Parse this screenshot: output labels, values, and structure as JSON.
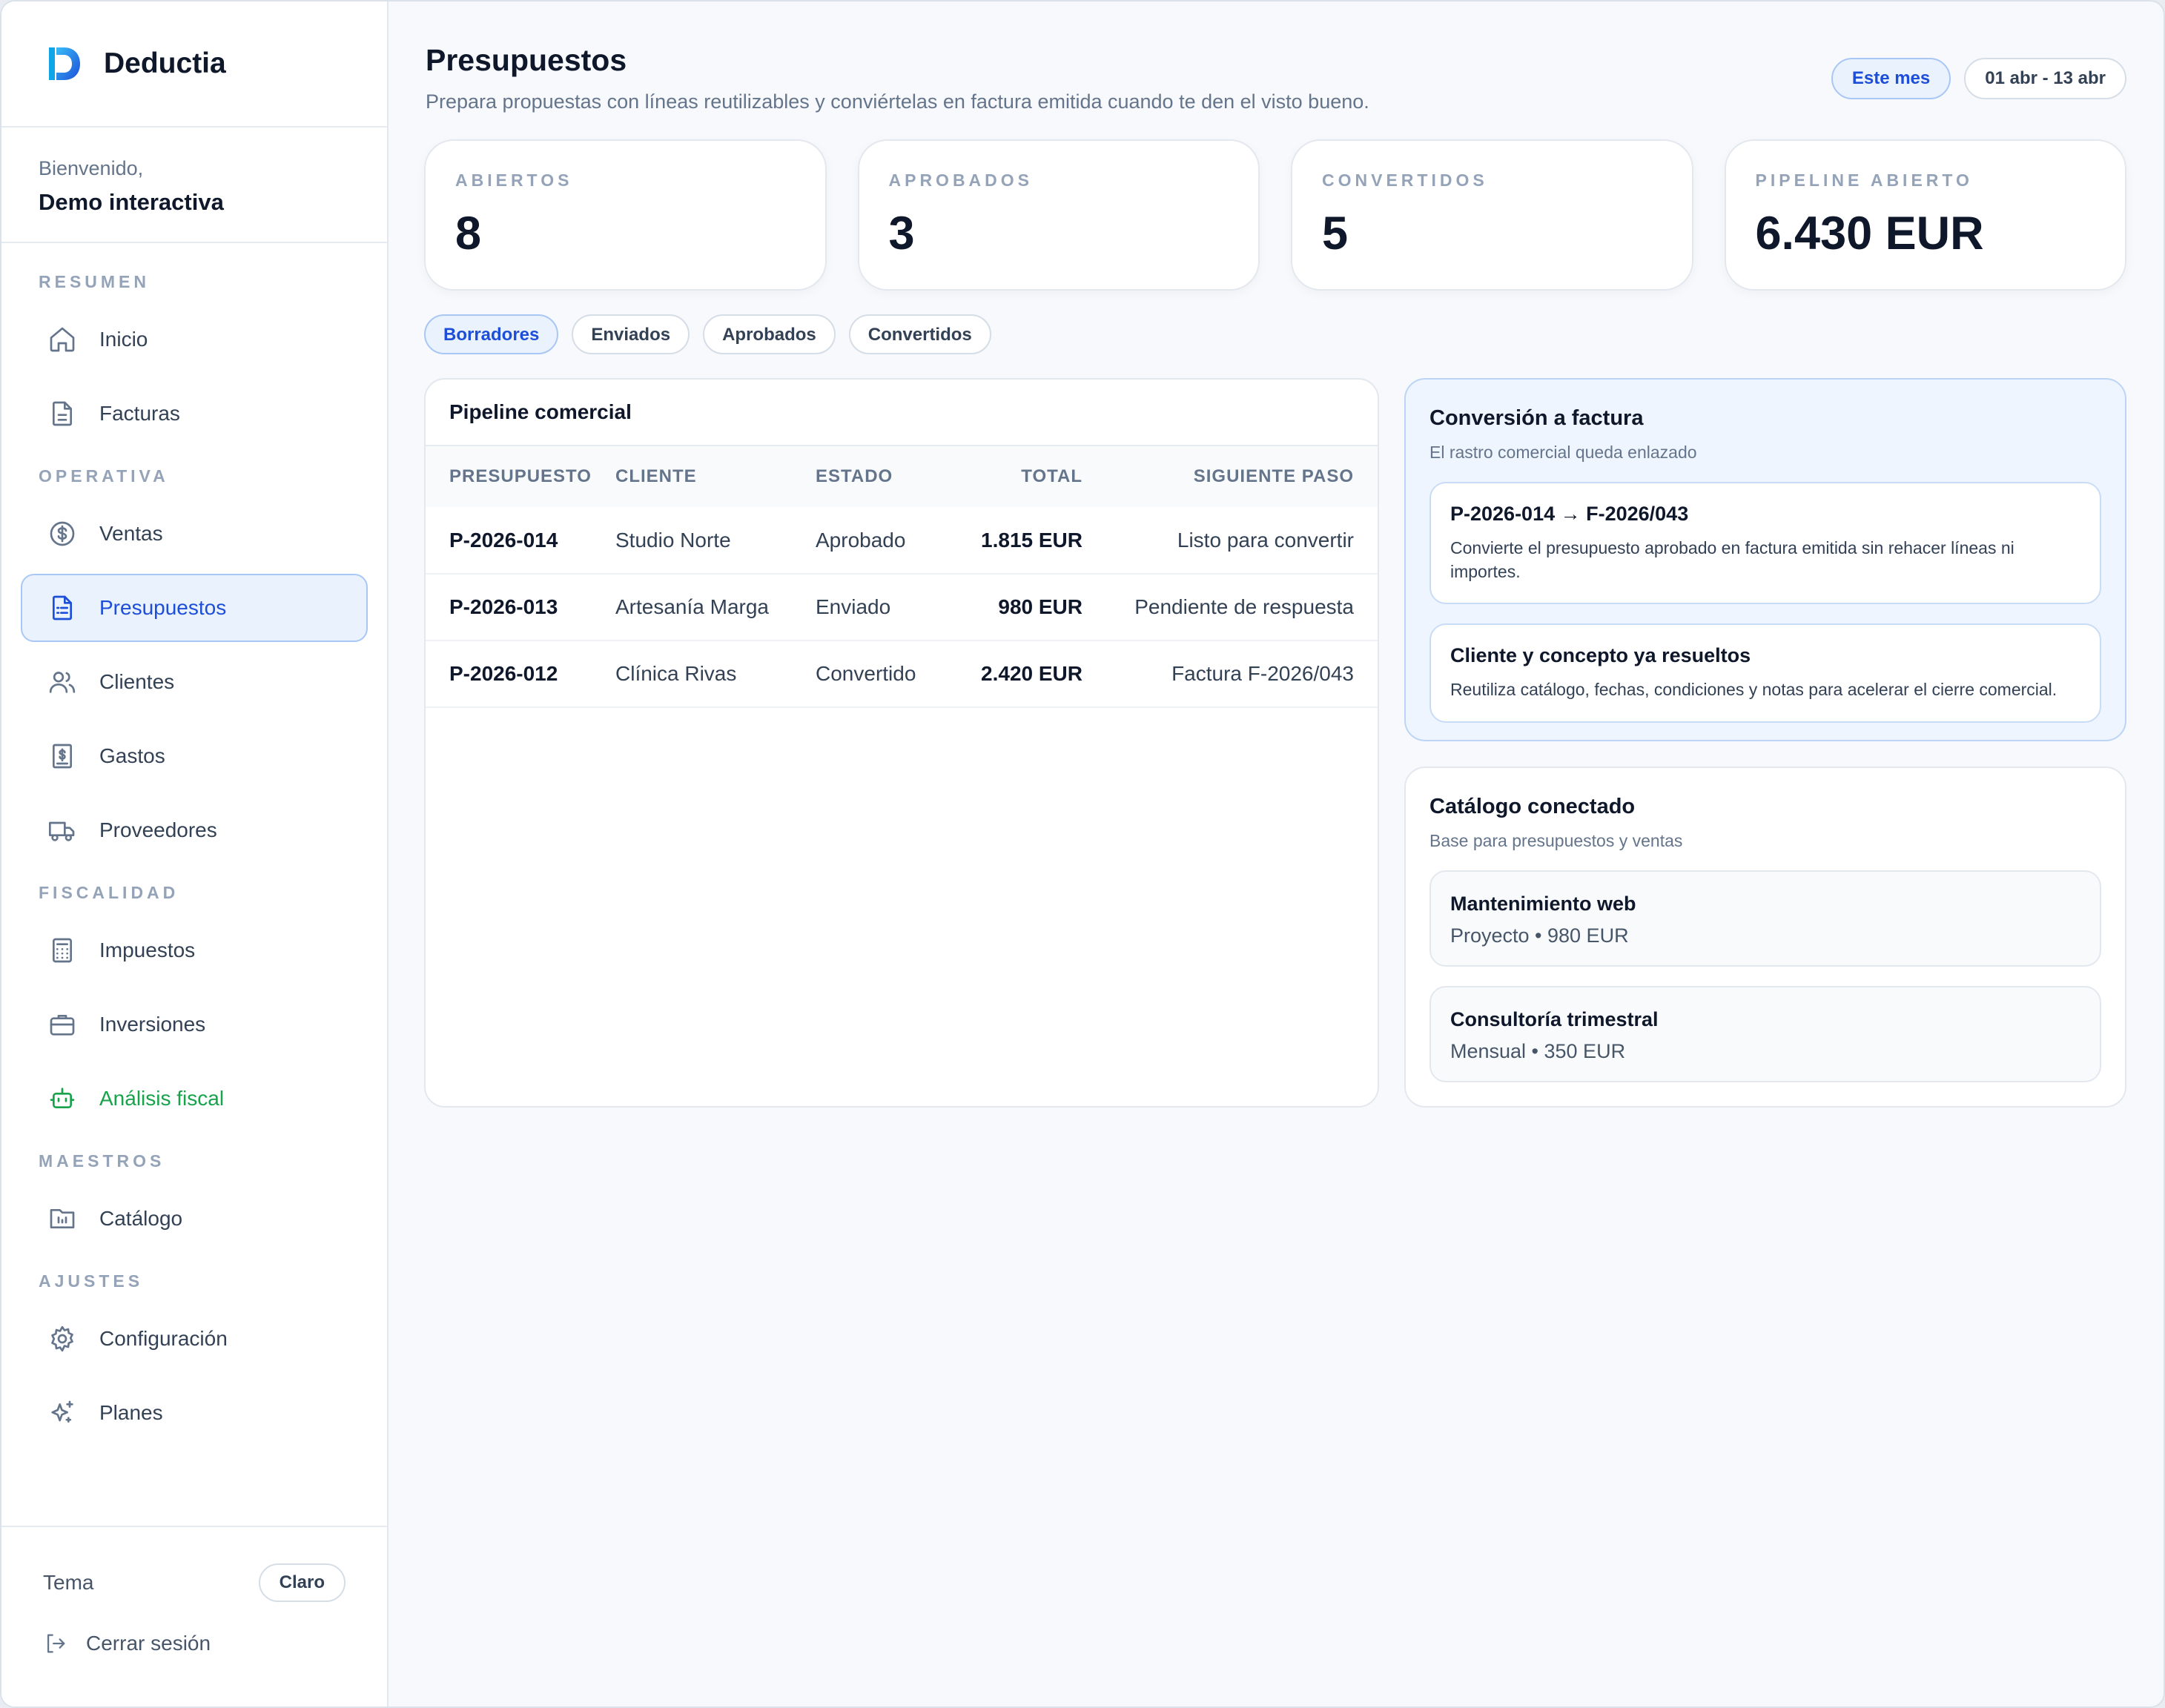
{
  "app": {
    "name": "Deductia",
    "welcome_label": "Bienvenido,",
    "user_name": "Demo interactiva"
  },
  "sidebar": {
    "sections": [
      {
        "title": "RESUMEN",
        "items": [
          {
            "label": "Inicio",
            "icon": "home-icon"
          },
          {
            "label": "Facturas",
            "icon": "file-icon"
          }
        ]
      },
      {
        "title": "OPERATIVA",
        "items": [
          {
            "label": "Ventas",
            "icon": "dollar-circle-icon"
          },
          {
            "label": "Presupuestos",
            "icon": "file-list-icon",
            "active": true
          },
          {
            "label": "Clientes",
            "icon": "users-icon"
          },
          {
            "label": "Gastos",
            "icon": "receipt-icon"
          },
          {
            "label": "Proveedores",
            "icon": "truck-icon"
          }
        ]
      },
      {
        "title": "FISCALIDAD",
        "items": [
          {
            "label": "Impuestos",
            "icon": "calculator-icon"
          },
          {
            "label": "Inversiones",
            "icon": "briefcase-icon"
          },
          {
            "label": "Análisis fiscal",
            "icon": "robot-icon"
          }
        ]
      },
      {
        "title": "MAESTROS",
        "items": [
          {
            "label": "Catálogo",
            "icon": "catalog-icon"
          }
        ]
      },
      {
        "title": "AJUSTES",
        "items": [
          {
            "label": "Configuración",
            "icon": "gear-icon"
          },
          {
            "label": "Planes",
            "icon": "sparkles-icon"
          }
        ]
      }
    ],
    "theme_label": "Tema",
    "theme_value": "Claro",
    "logout_label": "Cerrar sesión"
  },
  "header": {
    "title": "Presupuestos",
    "subtitle": "Prepara propuestas con líneas reutilizables y conviértelas en factura emitida cuando te den el visto bueno.",
    "period_label": "Este mes",
    "date_range": "01 abr - 13 abr"
  },
  "kpis": [
    {
      "label": "ABIERTOS",
      "value": "8"
    },
    {
      "label": "APROBADOS",
      "value": "3"
    },
    {
      "label": "CONVERTIDOS",
      "value": "5"
    },
    {
      "label": "PIPELINE ABIERTO",
      "value": "6.430 EUR"
    }
  ],
  "tabs": [
    "Borradores",
    "Enviados",
    "Aprobados",
    "Convertidos"
  ],
  "pipeline": {
    "title": "Pipeline comercial",
    "columns": [
      "PRESUPUESTO",
      "CLIENTE",
      "ESTADO",
      "TOTAL",
      "SIGUIENTE PASO"
    ],
    "rows": [
      {
        "id": "P-2026-014",
        "client": "Studio Norte",
        "status": "Aprobado",
        "total": "1.815 EUR",
        "next": "Listo para convertir"
      },
      {
        "id": "P-2026-013",
        "client": "Artesanía Marga",
        "status": "Enviado",
        "total": "980 EUR",
        "next": "Pendiente de respuesta"
      },
      {
        "id": "P-2026-012",
        "client": "Clínica Rivas",
        "status": "Convertido",
        "total": "2.420 EUR",
        "next": "Factura F-2026/043"
      }
    ]
  },
  "conversion": {
    "title": "Conversión a factura",
    "subtitle": "El rastro comercial queda enlazado",
    "cards": [
      {
        "title": "P-2026-014 → F-2026/043",
        "text": "Convierte el presupuesto aprobado en factura emitida sin rehacer líneas ni importes."
      },
      {
        "title": "Cliente y concepto ya resueltos",
        "text": "Reutiliza catálogo, fechas, condiciones y notas para acelerar el cierre comercial."
      }
    ]
  },
  "catalog": {
    "title": "Catálogo conectado",
    "subtitle": "Base para presupuestos y ventas",
    "items": [
      {
        "name": "Mantenimiento web",
        "meta": "Proyecto • 980 EUR"
      },
      {
        "name": "Consultoría trimestral",
        "meta": "Mensual • 350 EUR"
      }
    ]
  },
  "colors": {
    "accent": "#1d4ed8",
    "accent_bg": "#eaf2fe",
    "green": "#16a34a"
  }
}
